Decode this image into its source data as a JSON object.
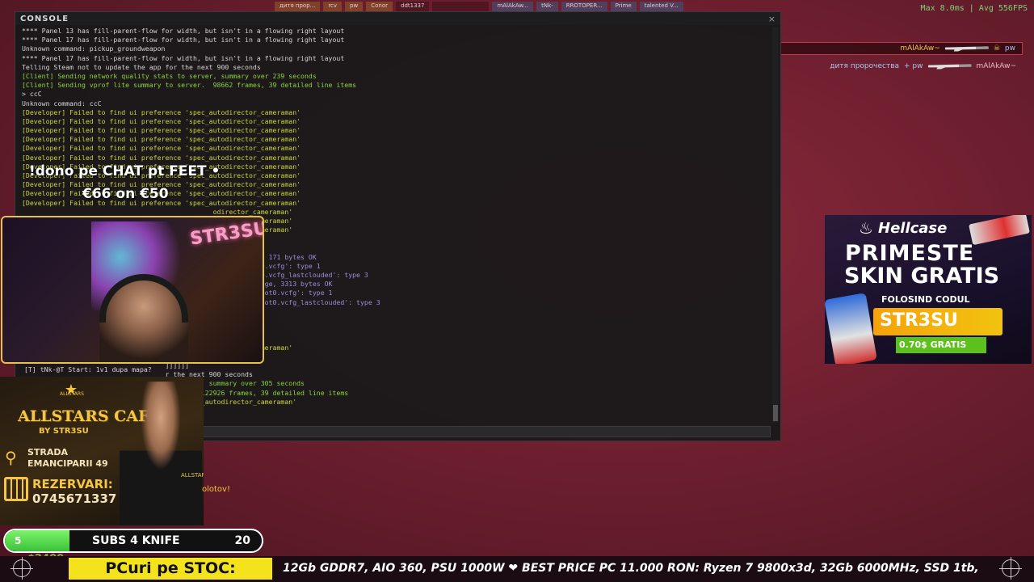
{
  "topbar": {
    "slots": [
      "дитя прор...",
      "rcv",
      "pw",
      "Conor",
      "ddt1337",
      "",
      "mAlAkAw...",
      "tNk-",
      "RROTOPER...",
      "Prime",
      "talented V..."
    ]
  },
  "perf": {
    "fps_text": "Max   8.0ms | Avg  556FPS"
  },
  "killfeed": {
    "row1": {
      "killer": "mAlAkAw~",
      "victim": "pw"
    },
    "row2": {
      "killer": "дитя пророчества",
      "assist": "+ pw",
      "victim": "mAlAkAw~"
    }
  },
  "console": {
    "title": "CONSOLE",
    "close": "×",
    "lines": [
      {
        "t": "**** Panel 13 has fill-parent-flow for width, but isn't in a flowing right layout",
        "c": "normal"
      },
      {
        "t": "**** Panel 17 has fill-parent-flow for width, but isn't in a flowing right layout",
        "c": "normal"
      },
      {
        "t": "Unknown command: pickup_groundweapon",
        "c": "normal"
      },
      {
        "t": "**** Panel 17 has fill-parent-flow for width, but isn't in a flowing right layout",
        "c": "normal"
      },
      {
        "t": "Telling Steam not to update the app for the next 900 seconds",
        "c": "normal"
      },
      {
        "t": "[Client] Sending network quality stats to server, summary over 239 seconds",
        "c": "green"
      },
      {
        "t": "[Client] Sending vprof lite summary to server.  98662 frames, 39 detailed line items",
        "c": "green"
      },
      {
        "t": "> ccC",
        "c": "normal"
      },
      {
        "t": "Unknown command: ccC",
        "c": "normal"
      },
      {
        "t": "[Developer] Failed to find ui preference 'spec_autodirector_cameraman'",
        "c": "dev"
      },
      {
        "t": "[Developer] Failed to find ui preference 'spec_autodirector_cameraman'",
        "c": "dev"
      },
      {
        "t": "[Developer] Failed to find ui preference 'spec_autodirector_cameraman'",
        "c": "dev"
      },
      {
        "t": "[Developer] Failed to find ui preference 'spec_autodirector_cameraman'",
        "c": "dev"
      },
      {
        "t": "[Developer] Failed to find ui preference 'spec_autodirector_cameraman'",
        "c": "dev"
      },
      {
        "t": "[Developer] Failed to find ui preference 'spec_autodirector_cameraman'",
        "c": "dev"
      },
      {
        "t": "[Developer] Failed to find ui preference 'spec_autodirector_cameraman'",
        "c": "dev"
      },
      {
        "t": "[Developer] Failed to find ui preference 'spec_autodirector_cameraman'",
        "c": "dev"
      },
      {
        "t": "[Developer] Failed to find ui preference 'spec_autodirector_cameraman'",
        "c": "dev"
      },
      {
        "t": "[Developer] Failed to find ui preference 'spec_autodirector_cameraman'",
        "c": "dev"
      },
      {
        "t": "[Developer] Failed to find ui preference 'spec_autodirector_cameraman'",
        "c": "dev"
      },
      {
        "t": "                                                odirector_cameraman'",
        "c": "dev"
      },
      {
        "t": "                                                odirector_cameraman'",
        "c": "dev"
      },
      {
        "t": "                                                odirector_cameraman'",
        "c": "dev"
      },
      {
        "t": "                                                595",
        "c": "green"
      },
      {
        "t": "",
        "c": "normal"
      },
      {
        "t": "                                                emoteStorage, 171 bytes OK",
        "c": "purple"
      },
      {
        "t": "                                                 keys_0_slot0.vcfg': type 1",
        "c": "purple"
      },
      {
        "t": "                                                 keys_0_slot0.vcfg_lastclouded': type 3",
        "c": "purple"
      },
      {
        "t": "                                                 mRemoteStorage, 3313 bytes OK",
        "c": "purple"
      },
      {
        "t": "                                                 convars_0_slot0.vcfg': type 1",
        "c": "purple"
      },
      {
        "t": "                                                 convars_0_slot0.vcfg_lastclouded': type 3",
        "c": "purple"
      },
      {
        "t": "",
        "c": "normal"
      },
      {
        "t": "",
        "c": "normal"
      },
      {
        "t": "",
        "c": "normal"
      },
      {
        "t": "",
        "c": "normal"
      },
      {
        "t": "                                                odirector_cameraman'",
        "c": "dev"
      },
      {
        "t": "",
        "c": "normal"
      },
      {
        "t": "                                    ]]]]]]",
        "c": "normal"
      },
      {
        "t": "                                    r the next 900 seconds",
        "c": "normal"
      },
      {
        "t": "                                    to server, summary over 305 seconds",
        "c": "green"
      },
      {
        "t": "                                    server.  122926 frames, 39 detailed line items",
        "c": "green"
      },
      {
        "t": "                                    nce 'spec_autodirector_cameraman'",
        "c": "dev"
      }
    ]
  },
  "donation": {
    "line1": "!dono pe CHAT pt FEET •",
    "line2": "€66 on €50"
  },
  "webcam": {
    "neon_sign": "STR3SU"
  },
  "chat": {
    "line": "[T] tNk-@T Start: 1v1 dupa mapa?"
  },
  "sponsor": {
    "logo_text": "ALLSTARS",
    "title": "ALLSTARS CAFÉ",
    "subtitle": "BY STR3SU",
    "street1": "STRADA",
    "street2": "EMANCIPARII 49",
    "reservations": "REZERVARI:",
    "phone": "0745671337",
    "shirt_logo": "ALLSTARS"
  },
  "ticker_side": {
    "molotov": "olotov!"
  },
  "subgoal": {
    "current": "5",
    "label": "SUBS 4 KNIFE",
    "goal": "20",
    "progress": 0.25
  },
  "money": {
    "value": "$2400"
  },
  "ticker": {
    "badge": "PCuri pe STOC:",
    "text": "12Gb GDDR7, AIO 360, PSU 1000W  ❤ BEST PRICE PC 11.000 RON: Ryzen 7 9800x3d, 32Gb 6000MHz, SSD 1tb,"
  },
  "hellcase": {
    "brand": "Hellcase",
    "title1": "PRIMESTE",
    "title2": "SKIN GRATIS",
    "using": "FOLOSIND CODUL",
    "code": "STR3SU",
    "bonus": "0.70$ GRATIS"
  }
}
